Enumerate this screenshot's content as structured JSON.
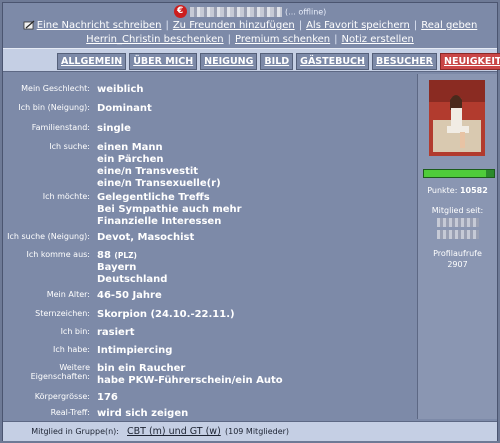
{
  "header": {
    "badge": "€",
    "status": "(... offline)",
    "actions_row1": [
      "Eine Nachricht schreiben",
      "Zu Freunden hinzufügen",
      "Als Favorit speichern",
      "Real geben"
    ],
    "actions_row2": [
      "Herrin_Christin beschenken",
      "Premium schenken",
      "Notiz erstellen"
    ]
  },
  "tabs": [
    {
      "label": "ALLGEMEIN",
      "active": false
    },
    {
      "label": "ÜBER MICH",
      "active": false
    },
    {
      "label": "NEIGUNG",
      "active": false
    },
    {
      "label": "BILD",
      "active": false
    },
    {
      "label": "GÄSTEBUCH",
      "active": false
    },
    {
      "label": "BESUCHER",
      "active": false
    },
    {
      "label": "NEUIGKEITEN",
      "active": true
    }
  ],
  "profile": [
    {
      "label": "Mein Geschlecht:",
      "value": [
        "weiblich"
      ]
    },
    {
      "label": "Ich bin (Neigung):",
      "value": [
        "Dominant"
      ]
    },
    {
      "label": "Familienstand:",
      "value": [
        "single"
      ]
    },
    {
      "label": "Ich suche:",
      "value": [
        "einen Mann",
        "ein Pärchen",
        "eine/n Transvestit",
        "eine/n Transexuelle(r)"
      ]
    },
    {
      "label": "Ich möchte:",
      "value": [
        "Gelegentliche Treffs",
        "Bei Sympathie auch mehr",
        "Finanzielle Interessen"
      ]
    },
    {
      "label": "Ich suche (Neigung):",
      "value": [
        "Devot, Masochist"
      ]
    },
    {
      "label": "Ich komme aus:",
      "value": [
        "88",
        "Bayern",
        "Deutschland"
      ],
      "plz": "(PLZ)"
    },
    {
      "label": "Mein Alter:",
      "value": [
        "46-50 Jahre"
      ]
    },
    {
      "label": "Sternzeichen:",
      "value": [
        "Skorpion (24.10.-22.11.)"
      ]
    },
    {
      "label": "Ich bin:",
      "value": [
        "rasiert"
      ]
    },
    {
      "label": "Ich habe:",
      "value": [
        "Intimpiercing"
      ]
    },
    {
      "label": "Weitere Eigenschaften:",
      "value": [
        "bin ein Raucher",
        "habe PKW-Führerschein/ein Auto"
      ]
    },
    {
      "label": "Körpergrösse:",
      "value": [
        "176"
      ]
    },
    {
      "label": "Real-Treff:",
      "value": [
        "wird sich zeigen"
      ]
    }
  ],
  "sidebar": {
    "points_label": "Punkte:",
    "points_value": "10582",
    "member_since_label": "Mitglied seit:",
    "profile_views_label": "Profilaufrufe",
    "profile_views_value": "2907",
    "progress_fraction": 0.88
  },
  "footer": {
    "label": "Mitglied in Gruppe(n):",
    "group_link": "CBT (m) und GT (w)",
    "member_count": "(109 Mitglieder)"
  },
  "colors": {
    "background": "#7d8aa8",
    "tab_bar": "#c5cfe4",
    "active_tab": "#c94747",
    "progress": "#4fcc3a",
    "badge": "#cc1e1e"
  }
}
